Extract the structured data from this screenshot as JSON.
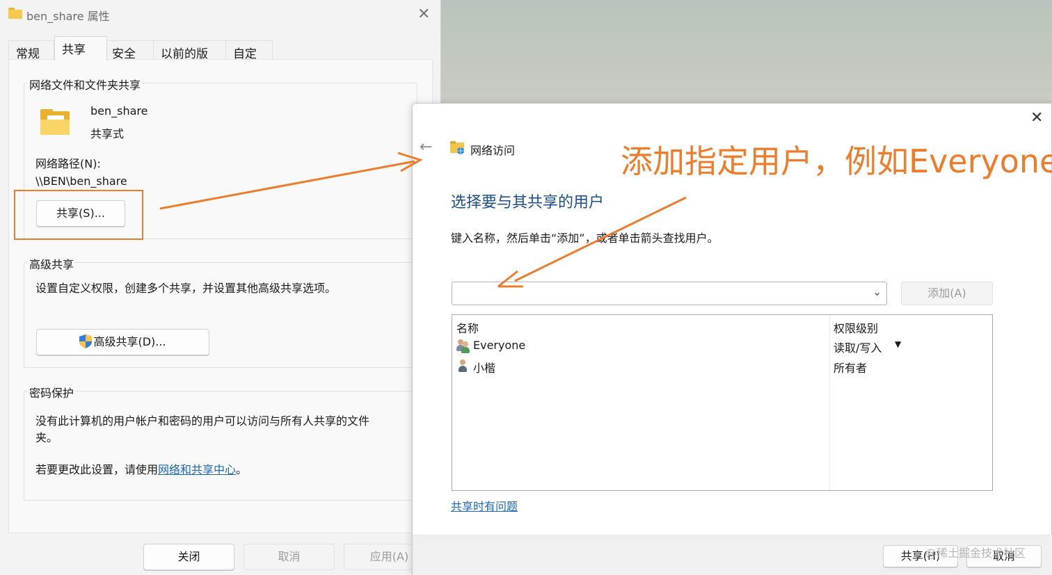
{
  "properties_window": {
    "title": "ben_share 属性",
    "tabs": [
      "常规",
      "共享",
      "安全",
      "以前的版本",
      "自定义"
    ],
    "network_sharing": {
      "legend": "网络文件和文件夹共享",
      "folder_name": "ben_share",
      "folder_state": "共享式",
      "network_path_label": "网络路径(N):",
      "network_path_value": "\\\\BEN\\ben_share",
      "share_button": "共享(S)..."
    },
    "advanced_sharing": {
      "legend": "高级共享",
      "description": "设置自定义权限，创建多个共享，并设置其他高级共享选项。",
      "button": "高级共享(D)..."
    },
    "password_protection": {
      "legend": "密码保护",
      "description_line1": "没有此计算机的用户帐户和密码的用户可以访问与所有人共享的文件",
      "description_line2": "夹。",
      "change_prefix": "若要更改此设置，请使用",
      "change_link": "网络和共享中心",
      "change_suffix": "。"
    },
    "footer": {
      "close": "关闭",
      "cancel": "取消",
      "apply": "应用(A)"
    }
  },
  "network_access_dialog": {
    "title": "网络访问",
    "heading": "选择要与其共享的用户",
    "instruction": "键入名称，然后单击“添加”，或者单击箭头查找用户。",
    "name_input_value": "",
    "add_button": "添加(A)",
    "columns": {
      "name": "名称",
      "permission": "权限级别"
    },
    "users": [
      {
        "name": "Everyone",
        "permission": "读取/写入",
        "icon": "group-users-icon"
      },
      {
        "name": "小楷",
        "permission": "所有者",
        "icon": "user-icon"
      }
    ],
    "help_link": "共享时有问题",
    "footer": {
      "share": "共享(H)",
      "cancel": "取消"
    }
  },
  "annotation": "添加指定用户，例如Everyone",
  "watermark": "@稀土掘金技术社区",
  "colors": {
    "annotation_orange": "#ee7c2b",
    "link_blue": "#1a66c2",
    "heading_blue": "#1b4f8f"
  }
}
